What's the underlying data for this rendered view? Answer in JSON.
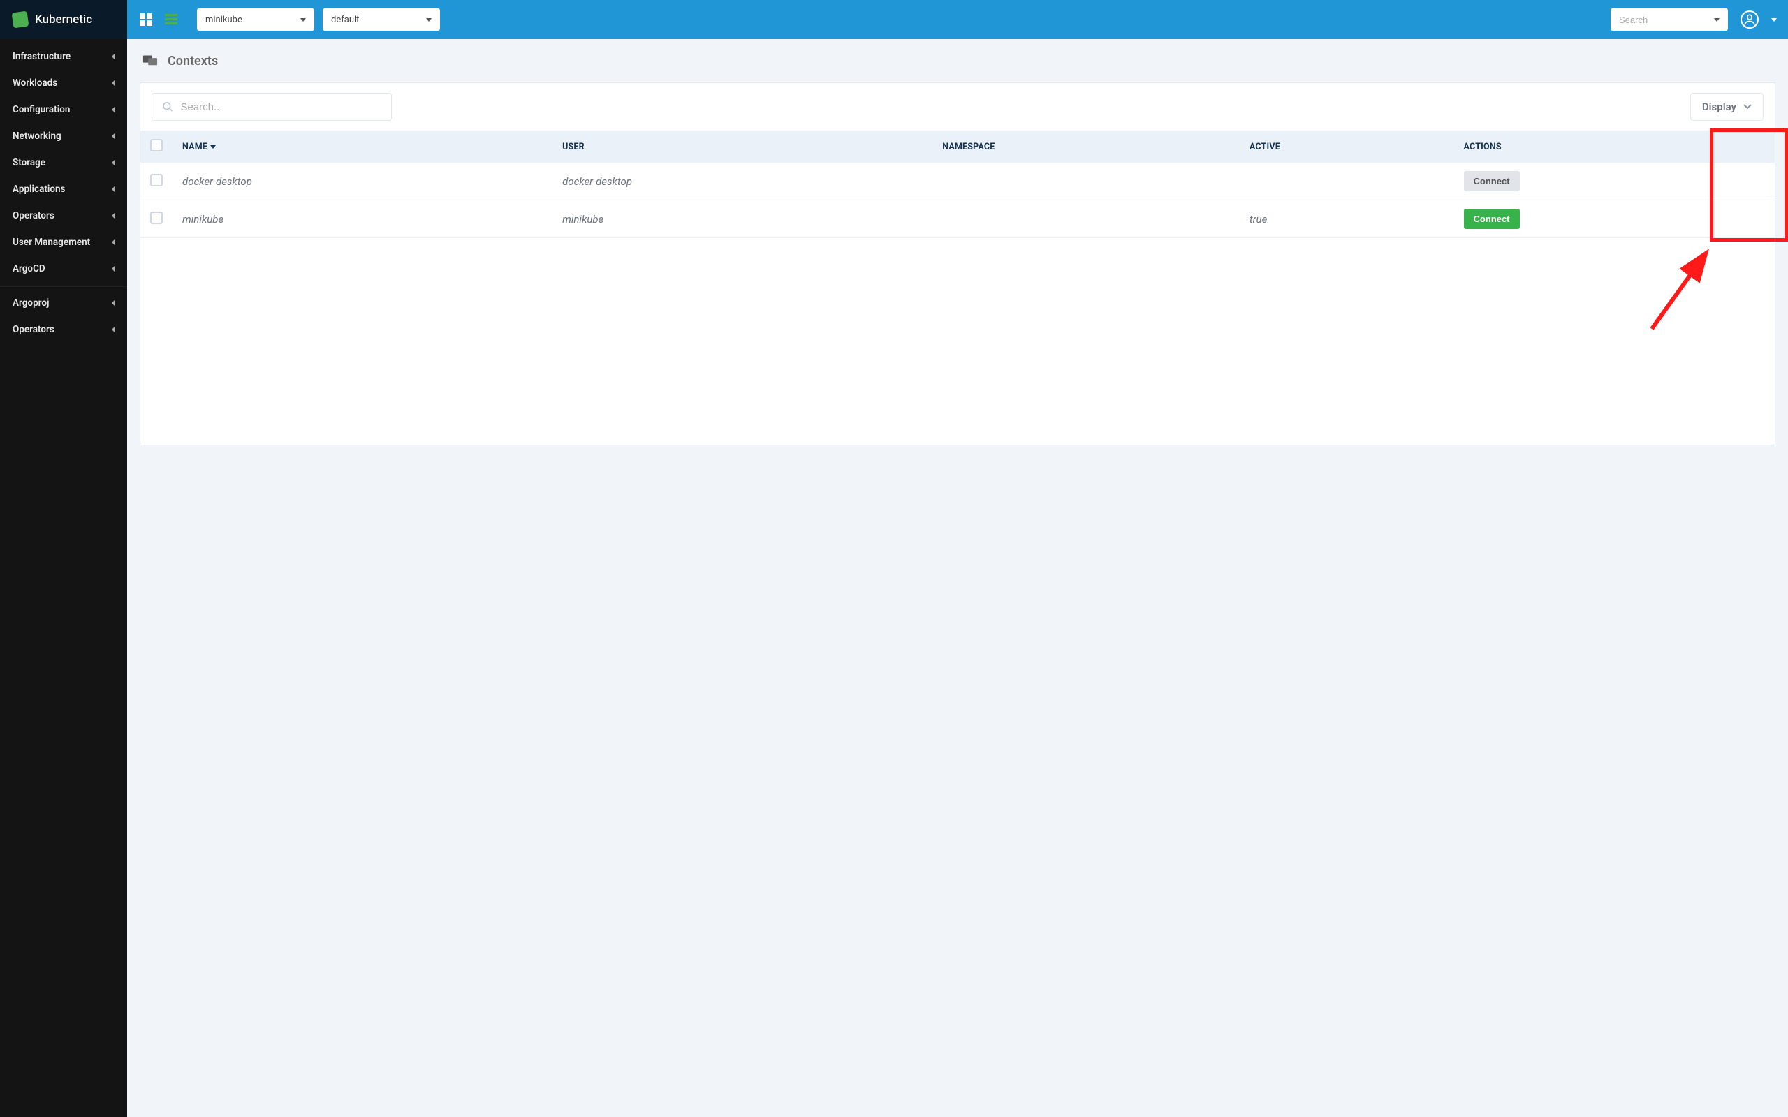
{
  "brand": {
    "name": "Kubernetic"
  },
  "topbar": {
    "context_selected": "minikube",
    "namespace_selected": "default",
    "search_placeholder": "Search"
  },
  "sidebar": {
    "group1": [
      {
        "label": "Infrastructure"
      },
      {
        "label": "Workloads"
      },
      {
        "label": "Configuration"
      },
      {
        "label": "Networking"
      },
      {
        "label": "Storage"
      },
      {
        "label": "Applications"
      },
      {
        "label": "Operators"
      },
      {
        "label": "User Management"
      },
      {
        "label": "ArgoCD"
      }
    ],
    "group2": [
      {
        "label": "Argoproj"
      },
      {
        "label": "Operators"
      }
    ]
  },
  "page": {
    "title": "Contexts",
    "search_placeholder": "Search...",
    "display_label": "Display"
  },
  "table": {
    "columns": {
      "name": "NAME",
      "user": "USER",
      "namespace": "NAMESPACE",
      "active": "ACTIVE",
      "actions": "ACTIONS"
    },
    "rows": [
      {
        "name": "docker-desktop",
        "user": "docker-desktop",
        "namespace": "",
        "active": "",
        "action_label": "Connect",
        "action_active": false
      },
      {
        "name": "minikube",
        "user": "minikube",
        "namespace": "",
        "active": "true",
        "action_label": "Connect",
        "action_active": true
      }
    ]
  }
}
